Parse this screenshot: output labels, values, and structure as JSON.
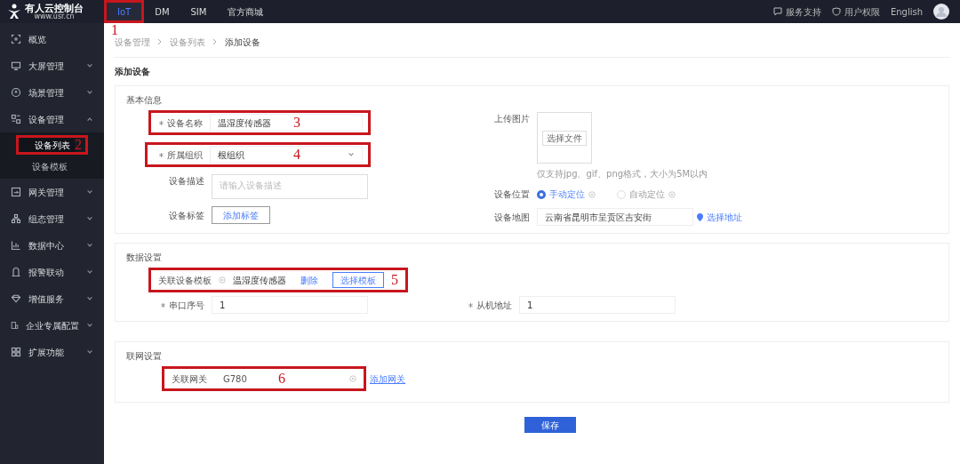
{
  "brand": {
    "name": "有人云控制台",
    "url": "www.usr.cn"
  },
  "top_nav": [
    {
      "label": "IoT",
      "selected": true,
      "annotation": "1"
    },
    {
      "label": "DM",
      "selected": false
    },
    {
      "label": "SIM",
      "selected": false
    },
    {
      "label": "官方商城",
      "selected": false
    }
  ],
  "top_right": [
    {
      "label": "服务支持"
    },
    {
      "label": "用户权限"
    },
    {
      "label": "English"
    }
  ],
  "sidebar": {
    "items": [
      {
        "label": "概览",
        "kind": "link"
      },
      {
        "label": "大屏管理",
        "kind": "group",
        "expanded": false
      },
      {
        "label": "场景管理",
        "kind": "group",
        "expanded": false
      },
      {
        "label": "设备管理",
        "kind": "group",
        "expanded": true,
        "children": [
          {
            "label": "设备列表",
            "selected": true,
            "annotation": "2"
          },
          {
            "label": "设备模板",
            "selected": false
          }
        ]
      },
      {
        "label": "网关管理",
        "kind": "group",
        "expanded": false
      },
      {
        "label": "组态管理",
        "kind": "group",
        "expanded": false
      },
      {
        "label": "数据中心",
        "kind": "group",
        "expanded": false
      },
      {
        "label": "报警联动",
        "kind": "group",
        "expanded": false
      },
      {
        "label": "增值服务",
        "kind": "group",
        "expanded": false
      },
      {
        "label": "企业专属配置",
        "kind": "group",
        "expanded": false
      },
      {
        "label": "扩展功能",
        "kind": "group",
        "expanded": false
      }
    ]
  },
  "breadcrumb": [
    "设备管理",
    "设备列表",
    "添加设备"
  ],
  "page_title": "添加设备",
  "basic_info": {
    "title": "基本信息",
    "device_name": {
      "label": "设备名称",
      "required": true,
      "value": "温湿度传感器",
      "annotation": "3"
    },
    "organization": {
      "label": "所属组织",
      "required": true,
      "value": "根组织",
      "annotation": "4"
    },
    "description": {
      "label": "设备描述",
      "placeholder": "请输入设备描述"
    },
    "tags": {
      "label": "设备标签",
      "button": "添加标签"
    },
    "image": {
      "label": "上传图片",
      "button": "选择文件",
      "hint": "仅支持jpg、gif、png格式，大小为5M以内"
    },
    "location": {
      "label": "设备位置",
      "options": [
        {
          "label": "手动定位",
          "selected": true
        },
        {
          "label": "自动定位",
          "selected": false
        }
      ]
    },
    "map": {
      "label": "设备地图",
      "value": "云南省昆明市呈贡区吉安街",
      "link": "选择地址"
    }
  },
  "data_settings": {
    "title": "数据设置",
    "template": {
      "label": "关联设备模板",
      "value": "温湿度传感器",
      "delete": "删除",
      "button": "选择模板",
      "annotation": "5"
    },
    "serial_port": {
      "label": "串口序号",
      "required": true,
      "value": "1"
    },
    "slave_address": {
      "label": "从机地址",
      "required": true,
      "value": "1"
    }
  },
  "network": {
    "title": "联网设置",
    "gateway": {
      "label": "关联网关",
      "value": "G780",
      "annotation": "6",
      "link": "添加网关"
    }
  },
  "save": "保存"
}
